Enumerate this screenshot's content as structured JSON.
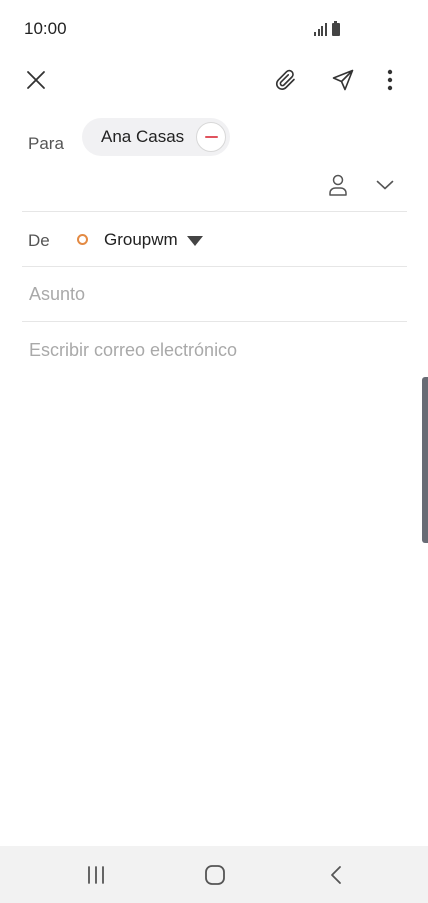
{
  "status_bar": {
    "time": "10:00",
    "icons": [
      "signal-icon",
      "battery-icon"
    ]
  },
  "toolbar": {
    "close_icon": "close-icon",
    "attach_icon": "paperclip-icon",
    "send_icon": "send-icon",
    "more_icon": "more-vertical-icon"
  },
  "recipients": {
    "to_label": "Para",
    "chips": [
      {
        "name": "Ana Casas",
        "remove_icon": "remove-icon"
      }
    ],
    "contact_icon": "contact-person-icon",
    "expand_icon": "chevron-down-icon"
  },
  "from": {
    "label": "De",
    "account": "Groupwm",
    "account_color": "#e38a43",
    "dropdown_icon": "caret-down-icon"
  },
  "compose": {
    "subject_placeholder": "Asunto",
    "subject_value": "",
    "body_placeholder": "Escribir correo electrónico",
    "body_value": ""
  },
  "colors": {
    "remove_accent": "#e0535e",
    "placeholder": "#a9a9a9",
    "chip_background": "#f1f1f3",
    "scroll_handle": "#686c75"
  },
  "nav_bar": {
    "recents_icon": "recents-icon",
    "home_icon": "home-icon",
    "back_icon": "back-icon"
  }
}
